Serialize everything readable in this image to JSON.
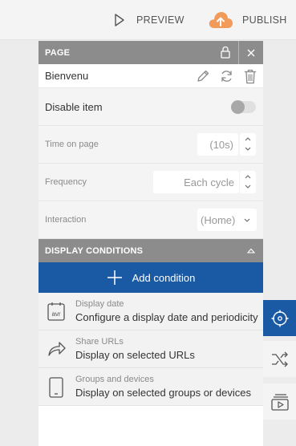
{
  "toolbar": {
    "preview_label": "PREVIEW",
    "publish_label": "PUBLISH",
    "publish_icon_color": "#f29a5a"
  },
  "panel": {
    "header_title": "PAGE",
    "item_name": "Bienvenu",
    "disable_item": {
      "label": "Disable item",
      "enabled": false
    },
    "time_on_page": {
      "label": "Time on page",
      "value": "(10s)"
    },
    "frequency": {
      "label": "Frequency",
      "value": "Each cycle"
    },
    "interaction": {
      "label": "Interaction",
      "value": "(Home)"
    }
  },
  "display_conditions": {
    "header_title": "DISPLAY CONDITIONS",
    "add_label": "Add condition",
    "items": [
      {
        "icon": "calendar-avr-icon",
        "title": "Display date",
        "description": "Configure a display date and periodicity"
      },
      {
        "icon": "share-arrow-icon",
        "title": "Share URLs",
        "description": "Display on selected URLs"
      },
      {
        "icon": "device-icon",
        "title": "Groups and devices",
        "description": "Display on selected groups or devices"
      }
    ]
  },
  "colors": {
    "accent": "#1a5aa5",
    "header_gray": "#8c8c8c"
  }
}
